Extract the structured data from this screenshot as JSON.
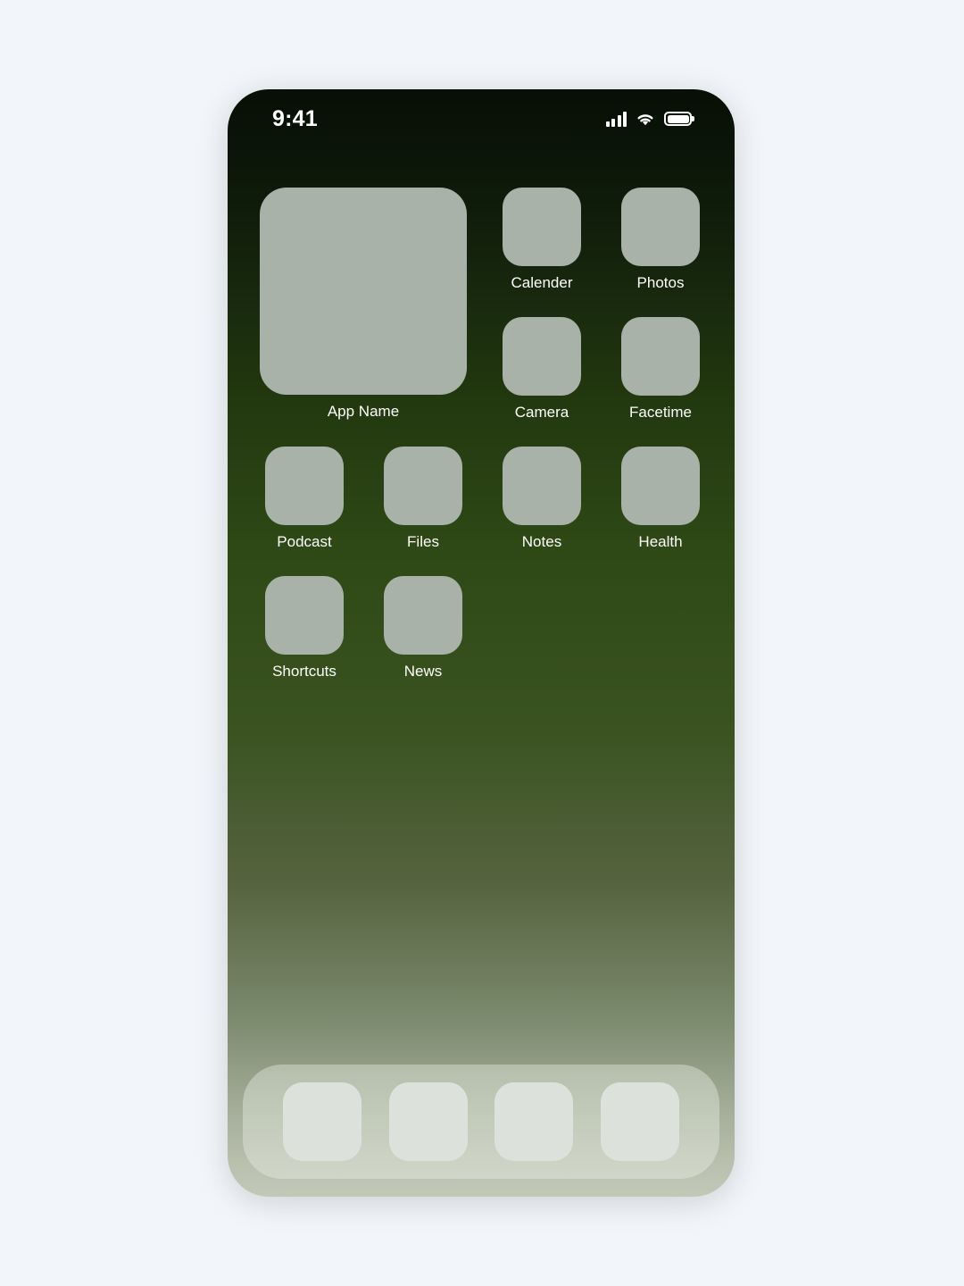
{
  "page": {
    "background_color": "#f2f5fa"
  },
  "device": {
    "frame_radius_px": 46,
    "wallpaper": {
      "type": "vertical-gradient",
      "top_color": "#080f06",
      "mid_color": "#3a5320",
      "bottom_color": "#c2c8b8"
    }
  },
  "status_bar": {
    "time": "9:41",
    "icons": [
      {
        "name": "cellular-signal-icon",
        "bars": 4,
        "filled": 4
      },
      {
        "name": "wifi-icon",
        "strength": "full"
      },
      {
        "name": "battery-icon",
        "level_percent": 100
      }
    ],
    "text_color": "#ffffff"
  },
  "home_screen": {
    "widget": {
      "label": "App Name",
      "size": "2x2",
      "fill_color": "#a9b2a8"
    },
    "apps": [
      {
        "label": "Calender",
        "row": 1,
        "col": 3
      },
      {
        "label": "Photos",
        "row": 1,
        "col": 4
      },
      {
        "label": "Camera",
        "row": 2,
        "col": 3
      },
      {
        "label": "Facetime",
        "row": 2,
        "col": 4
      },
      {
        "label": "Podcast",
        "row": 3,
        "col": 1
      },
      {
        "label": "Files",
        "row": 3,
        "col": 2
      },
      {
        "label": "Notes",
        "row": 3,
        "col": 3
      },
      {
        "label": "Health",
        "row": 3,
        "col": 4
      },
      {
        "label": "Shortcuts",
        "row": 4,
        "col": 1
      },
      {
        "label": "News",
        "row": 4,
        "col": 2
      }
    ],
    "app_icon_fill": "#a9b2a8",
    "label_color": "#ffffff"
  },
  "dock": {
    "background_color": "rgba(233,238,228,.42)",
    "icon_fill": "#dde1db",
    "items": [
      {
        "label": ""
      },
      {
        "label": ""
      },
      {
        "label": ""
      },
      {
        "label": ""
      }
    ]
  }
}
